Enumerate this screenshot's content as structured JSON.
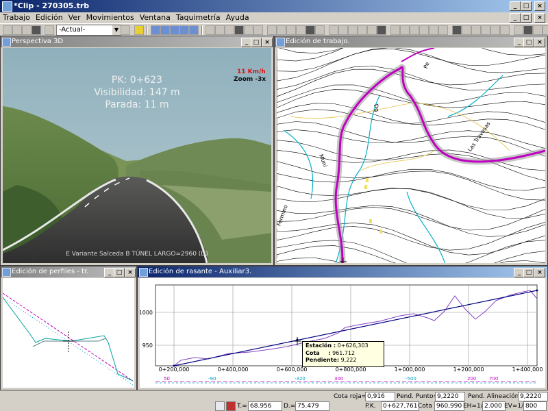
{
  "app": {
    "title": "*Clip - 270305.trb"
  },
  "menu": [
    "Trabajo",
    "Edición",
    "Ver",
    "Movimientos",
    "Ventana",
    "Taquimetría",
    "Ayuda"
  ],
  "toolbar": {
    "combo_value": "-Actual-"
  },
  "windows": {
    "persp": {
      "title": "Perspectiva 3D"
    },
    "trabajo": {
      "title": "Edición de trabajo."
    },
    "perfiles": {
      "title": "Edición de perfiles - tr."
    },
    "rasante": {
      "title": "Edición de rasante - Auxiliar3."
    }
  },
  "persp": {
    "pk": "PK: 0+623",
    "visibilidad": "Visibilidad: 147 m",
    "parada": "Parada: 11 m",
    "speed": "11 Km/h",
    "zoom": "Zoom -3x",
    "caption": "E Variante Salceda B TÚNEL LARGO=2960 (D)"
  },
  "map": {
    "labels": {
      "pe": "Pe",
      "dg": "Dg",
      "muni": "Muni",
      "travesas": "Las Travesas",
      "fermino": "Fermino"
    }
  },
  "rasante": {
    "y_ticks": [
      "1000",
      "950"
    ],
    "x_ticks": [
      "0+200,000",
      "0+400,000",
      "0+600,000",
      "0+800,000",
      "1+000,000",
      "1+200,000",
      "1+400,000"
    ],
    "bottom_numbers": [
      {
        "text": "50",
        "color": "#c000c0"
      },
      {
        "text": "-90",
        "color": "#00a0c0"
      },
      {
        "text": "-320",
        "color": "#00a0c0"
      },
      {
        "text": "300",
        "color": "#c000c0"
      },
      {
        "text": "-500",
        "color": "#00a0c0"
      },
      {
        "text": "200",
        "color": "#c000c0"
      },
      {
        "text": "700",
        "color": "#c000c0"
      }
    ],
    "tooltip": {
      "estacion_label": "Estación :",
      "estacion_value": "0+626,303",
      "cota_label": "Cota",
      "cota_sep": ":",
      "cota_value": "961.712",
      "pend_label": "Pendiente:",
      "pend_value": "9,222"
    }
  },
  "status": {
    "cota_roja_label": "Cota roja=",
    "cota_roja": "0,916",
    "pend_punto_label": "Pend. Punto=",
    "pend_punto": "9,2220",
    "pend_alin_label": "Pend. Alineación=",
    "pend_alin": "9,2220",
    "t_label": "T.=",
    "t_value": "68.956",
    "d_label": "D.=",
    "d_value": "75.479",
    "pk_label": "P.K.",
    "pk_value": "0+627,761",
    "cota_label": "Cota",
    "cota_value": "960,990",
    "eh_label": "EH=1/",
    "eh_value": "2.000",
    "ev_label": "EV=1/",
    "ev_value": "800"
  },
  "colors": {
    "alignment": "#c000c0",
    "water": "#00b0c8",
    "contour": "#000000",
    "grade": "#000080",
    "terrain_profile": "#8040c0"
  }
}
